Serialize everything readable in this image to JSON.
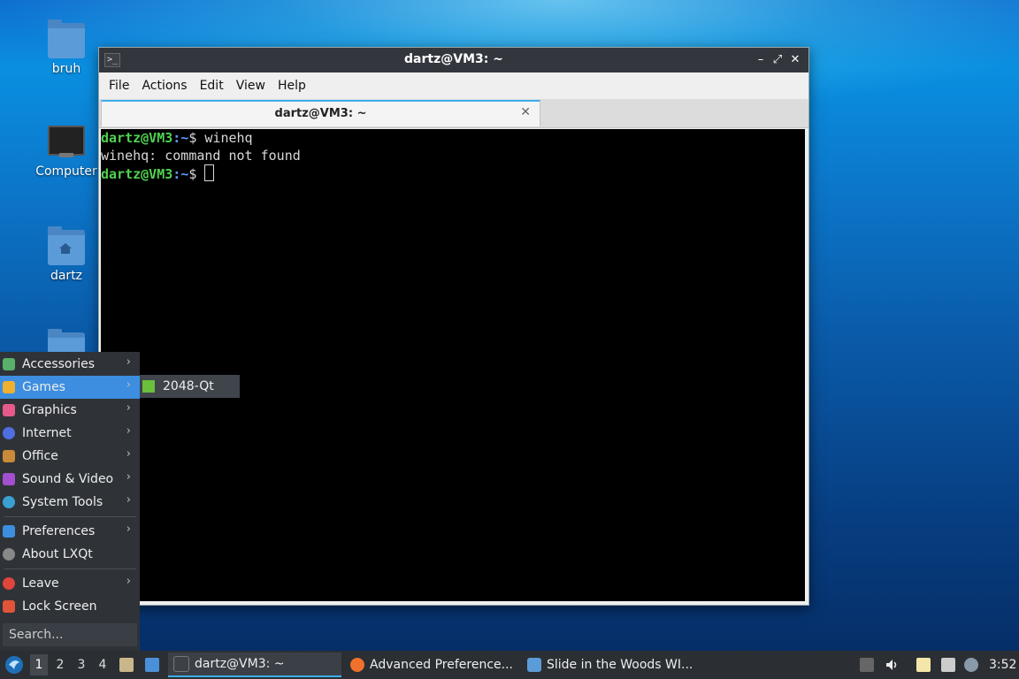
{
  "desktop": {
    "icons": [
      {
        "label": "bruh"
      },
      {
        "label": "Computer"
      },
      {
        "label": "dartz"
      }
    ]
  },
  "window": {
    "title": "dartz@VM3: ~",
    "controls": {
      "minimize": "–",
      "maximize": "⤢",
      "close": "✕"
    },
    "menu": [
      "File",
      "Actions",
      "Edit",
      "View",
      "Help"
    ],
    "tab": {
      "label": "dartz@VM3: ~",
      "close": "✕"
    },
    "terminal": {
      "lines": [
        {
          "user": "dartz@VM3",
          "path": ":~",
          "suffix": "$ winehq"
        },
        {
          "text": "winehq: command not found"
        },
        {
          "user": "dartz@VM3",
          "path": ":~",
          "suffix": "$ "
        }
      ]
    }
  },
  "startmenu": {
    "items": [
      {
        "label": "Accessories",
        "icon": "accessories-icon",
        "color": "#58b06a"
      },
      {
        "label": "Games",
        "icon": "games-icon",
        "color": "#f0b030"
      },
      {
        "label": "Graphics",
        "icon": "graphics-icon",
        "color": "#e55a8a"
      },
      {
        "label": "Internet",
        "icon": "internet-icon",
        "color": "#4d6fe0"
      },
      {
        "label": "Office",
        "icon": "office-icon",
        "color": "#c98a3a"
      },
      {
        "label": "Sound & Video",
        "icon": "sound-video-icon",
        "color": "#a24fd0"
      },
      {
        "label": "System Tools",
        "icon": "system-tools-icon",
        "color": "#3aa0d0"
      },
      {
        "label": "Preferences",
        "icon": "preferences-icon",
        "color": "#3d8ee0"
      },
      {
        "label": "About LXQt",
        "icon": "about-icon",
        "color": "#888888"
      },
      {
        "label": "Leave",
        "icon": "leave-icon",
        "color": "#e0453a"
      },
      {
        "label": "Lock Screen",
        "icon": "lock-icon",
        "color": "#e0553a"
      }
    ],
    "search_placeholder": "Search...",
    "submenu": {
      "label": "2048-Qt"
    },
    "arrow": "›"
  },
  "taskbar": {
    "desktops": [
      "1",
      "2",
      "3",
      "4"
    ],
    "tasks": [
      {
        "label": "dartz@VM3: ~"
      },
      {
        "label": "Advanced Preference..."
      },
      {
        "label": "Slide in the Woods WI..."
      }
    ],
    "clock": "3:52"
  }
}
